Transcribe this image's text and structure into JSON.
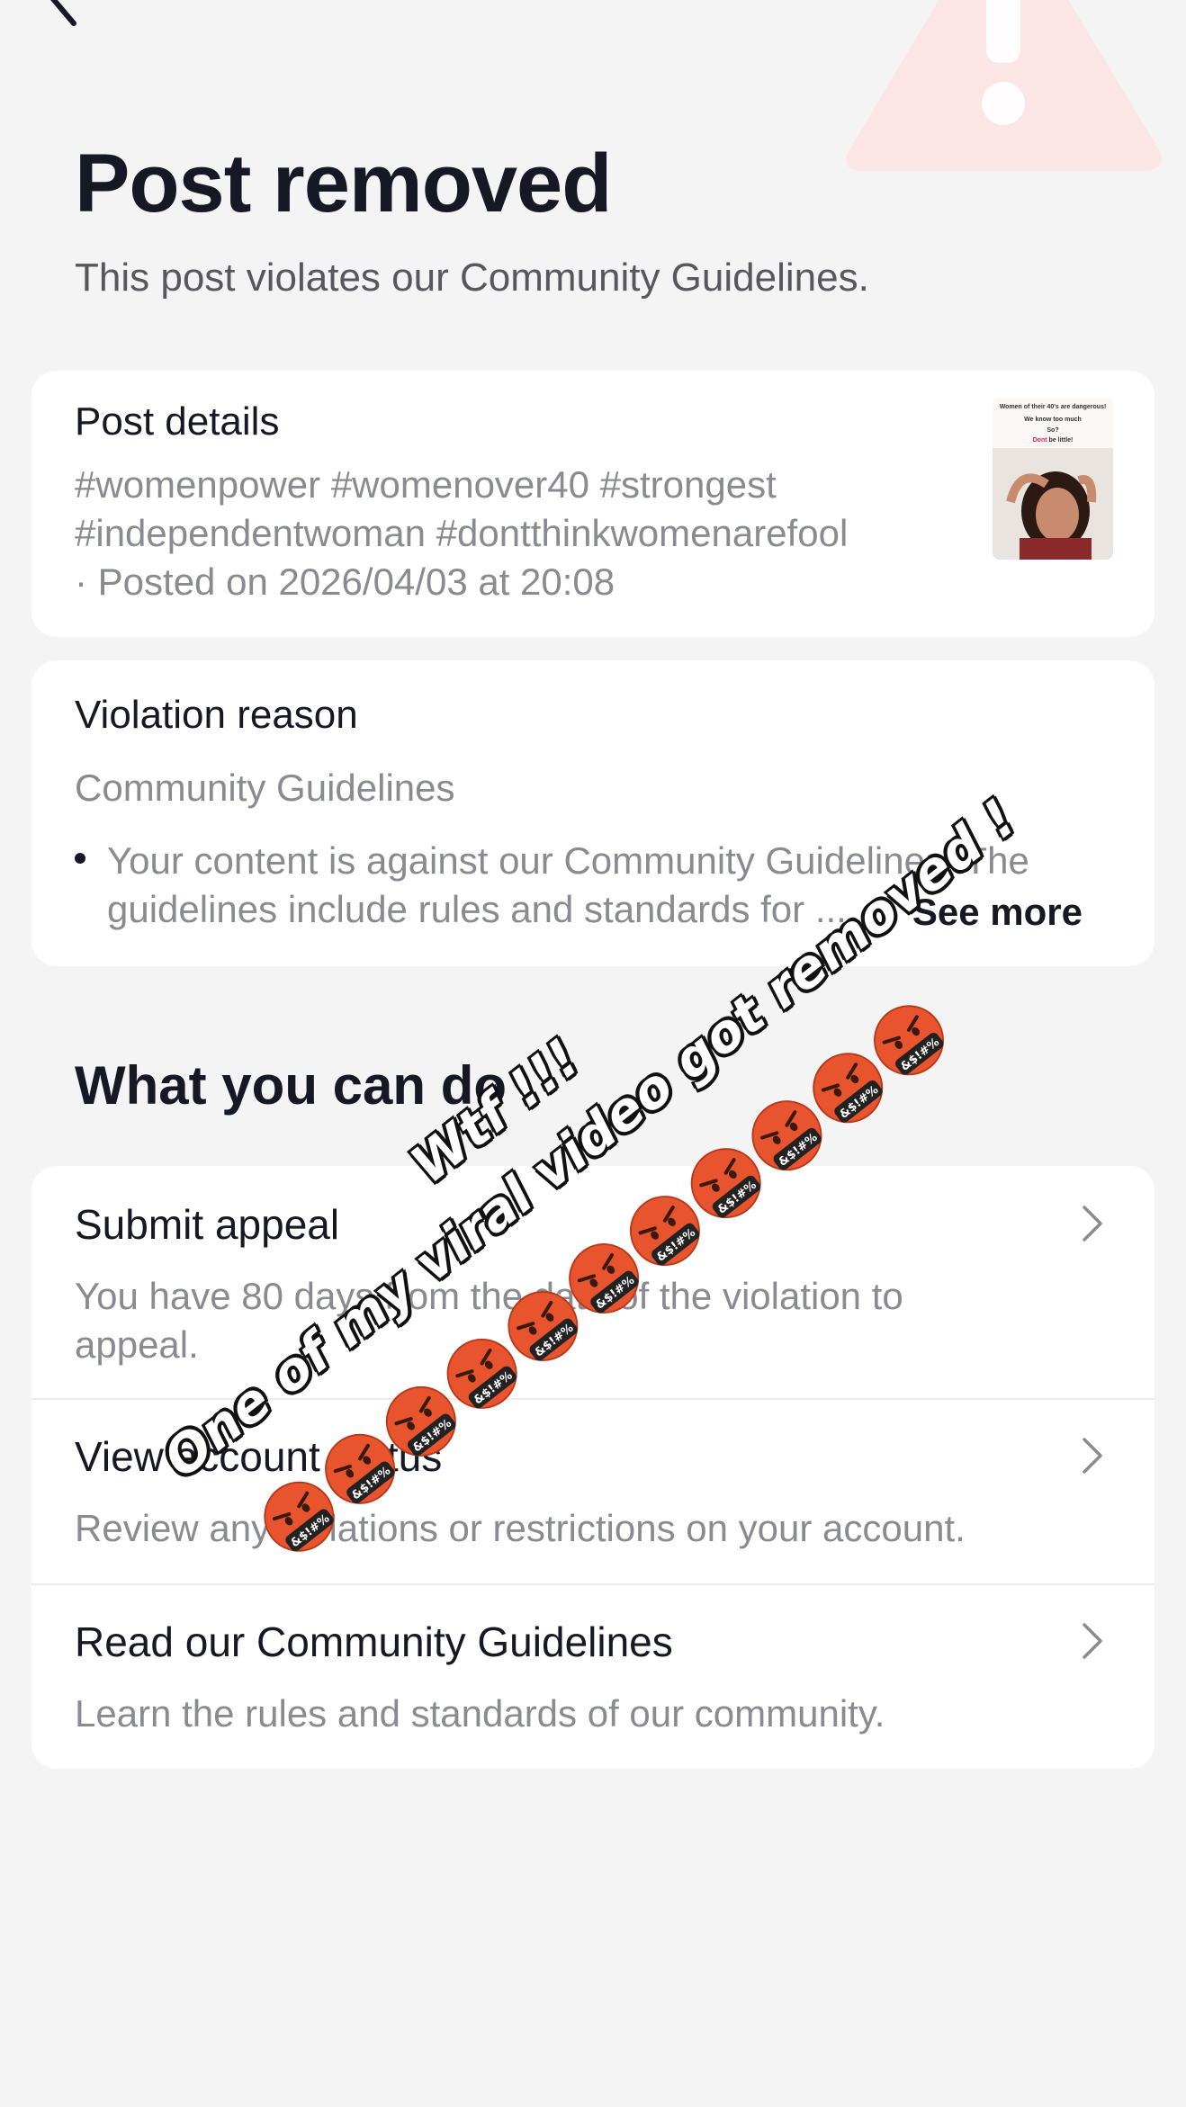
{
  "header": {
    "back_icon": "chevron-left-icon",
    "title": "Post removed",
    "subtitle": "This post violates our Community Guidelines."
  },
  "post_details": {
    "title": "Post details",
    "hashtags_line1": "#womenpower #womenover40 #strongest",
    "hashtags_line2": "#independentwoman #dontthinkwomenarefool",
    "posted": "· Posted on 2026/04/03 at 20:08",
    "thumbnail": {
      "line1": "Women of their 40's are dangerous!",
      "line2": "We know too much",
      "line3": "So?",
      "line4a": "Dont",
      "line4b": "be little!"
    }
  },
  "violation": {
    "title": "Violation reason",
    "category": "Community Guidelines",
    "bullet_line1": "Your content is against our Community Guidelines. The",
    "bullet_line2": "guidelines include rules and standards for ...",
    "see_more": "See more"
  },
  "actions": {
    "section_title": "What you can do",
    "items": [
      {
        "title": "Submit appeal",
        "desc_line1": "You have 80 days from the date of the violation to",
        "desc_line2": "appeal."
      },
      {
        "title": "View account status",
        "desc_line1": "Review any violations or restrictions on your account."
      },
      {
        "title": "Read our Community Guidelines",
        "desc_line1": "Learn the rules and standards of our community."
      }
    ]
  },
  "overlay": {
    "sticker_1": "Wtf !!!",
    "sticker_2": "One of my viral video got removed !",
    "emoji_symbol_text": "&$!#%",
    "emoji_name": "face-with-symbols-on-mouth-icon"
  },
  "colors": {
    "background": "#f4f4f4",
    "card": "#ffffff",
    "title_text": "#161823",
    "muted_text": "#8a8b91",
    "warning_tint": "#fbe3e3",
    "emoji_face": "#e8542e"
  }
}
